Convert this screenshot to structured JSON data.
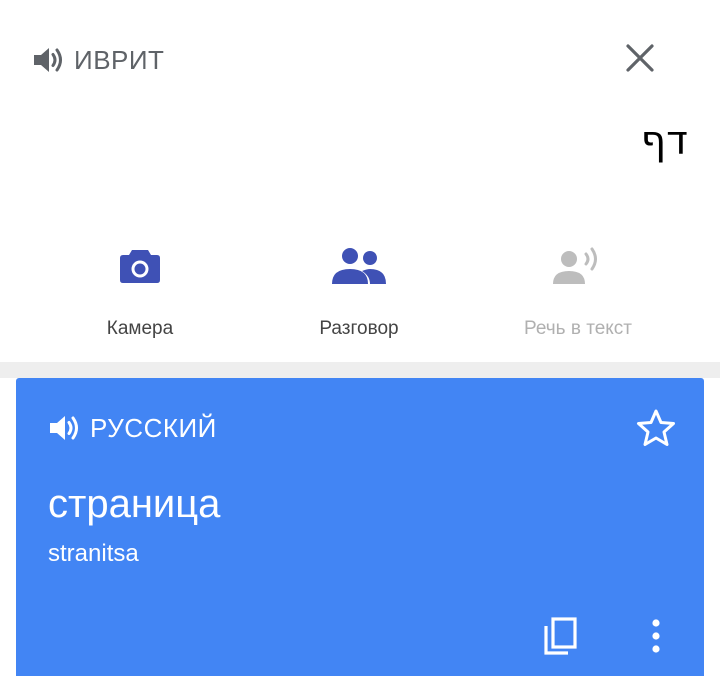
{
  "source": {
    "language": "ИВРИТ",
    "text": "דף",
    "speaker_icon": "volume-icon",
    "close_icon": "close-icon"
  },
  "tools": [
    {
      "label": "Камера",
      "icon": "camera-icon",
      "enabled": true
    },
    {
      "label": "Разговор",
      "icon": "conversation-icon",
      "enabled": true
    },
    {
      "label": "Речь в текст",
      "icon": "transcribe-icon",
      "enabled": false
    }
  ],
  "result": {
    "language": "РУССКИЙ",
    "translation": "страница",
    "transliteration": "stranitsa",
    "icons": [
      "volume-icon",
      "star-outline-icon",
      "copy-icon",
      "more-vert-icon"
    ]
  },
  "colors": {
    "accent": "#4285f4",
    "tool_icon": "#3f51b5",
    "tool_icon_disabled": "#bdbdbd",
    "muted_text": "#5f6368"
  }
}
